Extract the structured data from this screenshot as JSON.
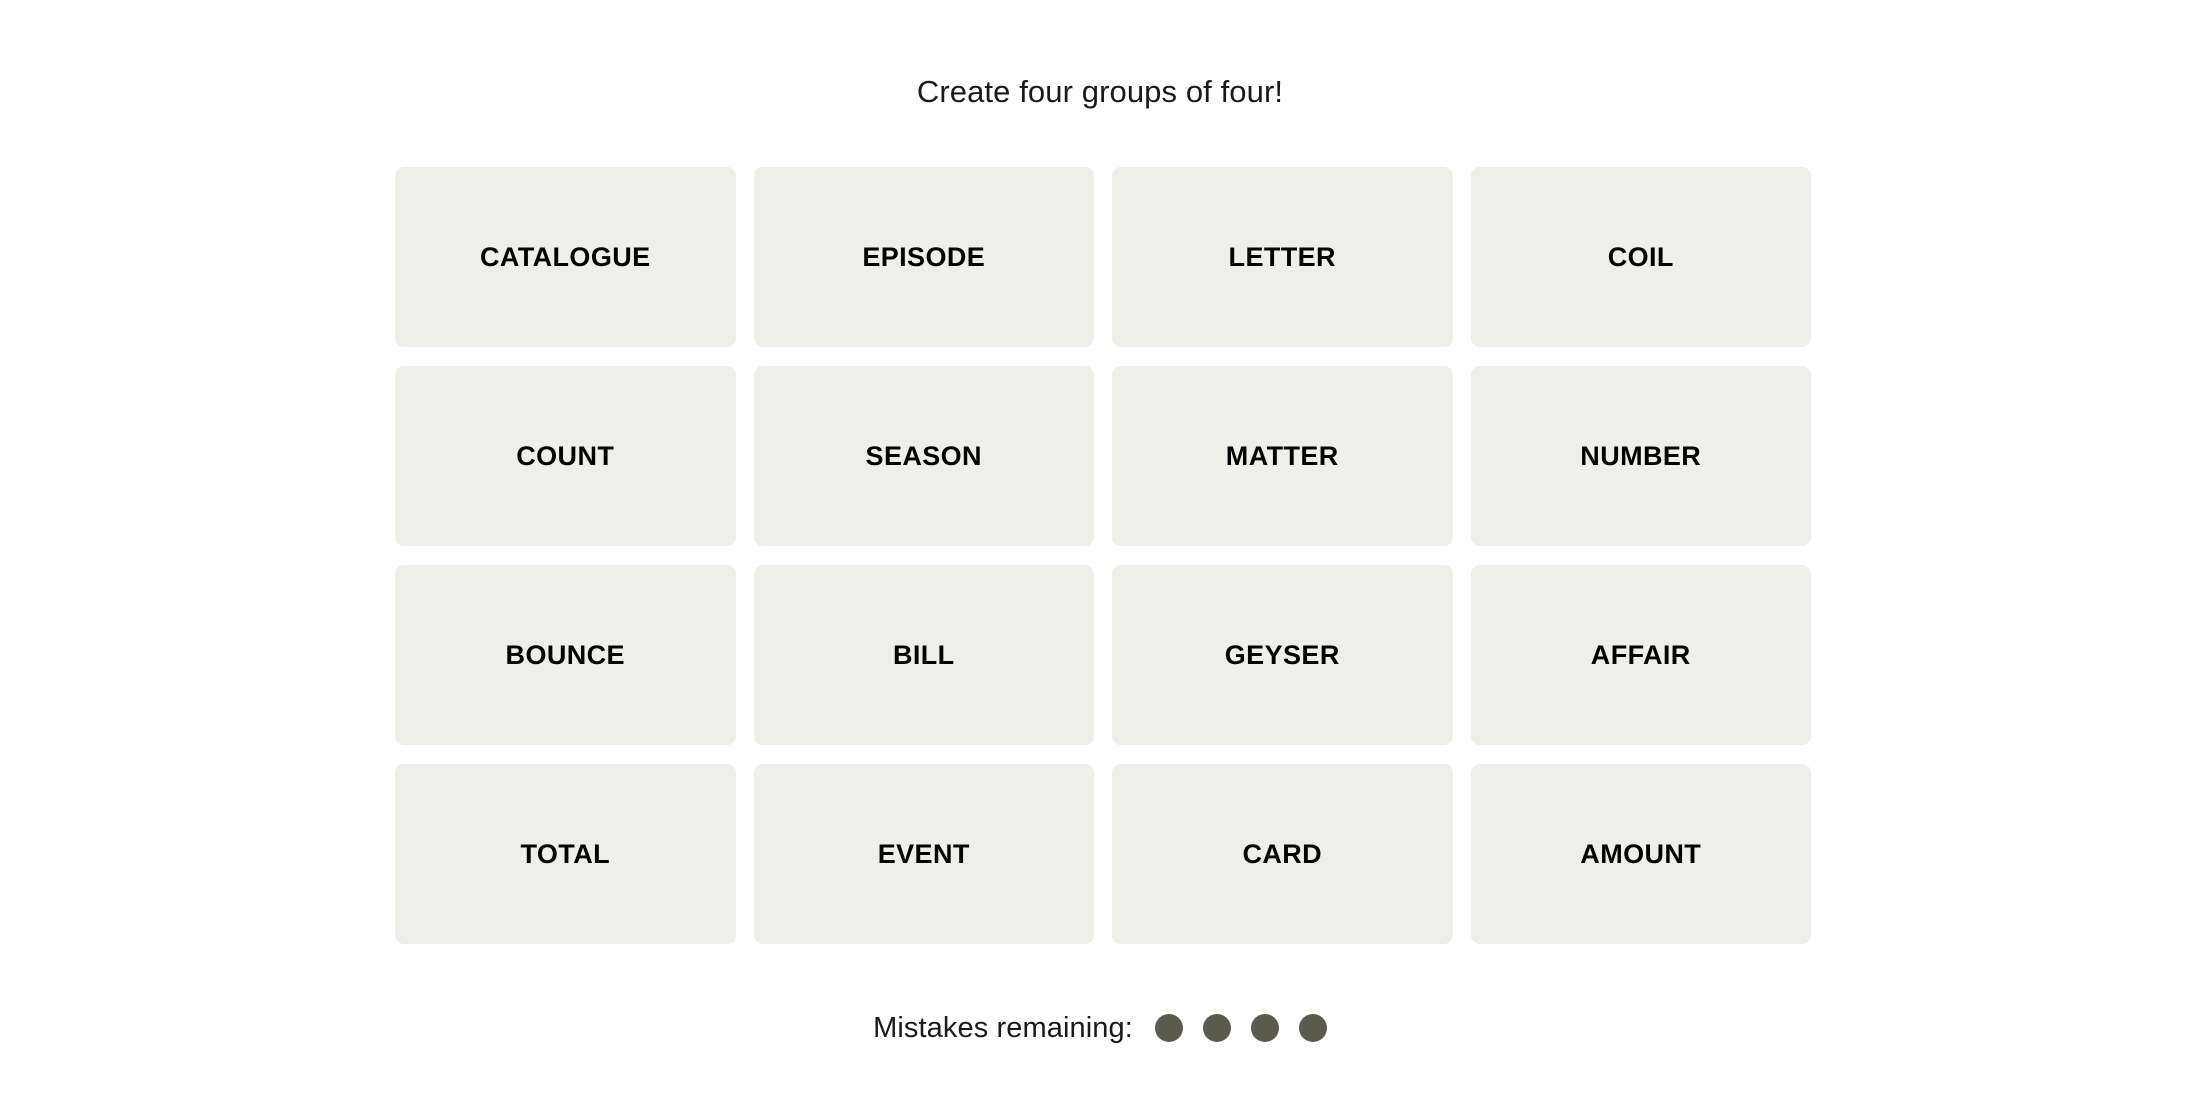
{
  "page": {
    "background_color": "#ffffff"
  },
  "header": {
    "instruction": "Create four groups of four!"
  },
  "board": {
    "rows": 4,
    "columns": 4,
    "tile_background_color": "#efefe9",
    "tile_text_color": "#020202",
    "tiles": [
      {
        "label": "CATALOGUE"
      },
      {
        "label": "EPISODE"
      },
      {
        "label": "LETTER"
      },
      {
        "label": "COIL"
      },
      {
        "label": "COUNT"
      },
      {
        "label": "SEASON"
      },
      {
        "label": "MATTER"
      },
      {
        "label": "NUMBER"
      },
      {
        "label": "BOUNCE"
      },
      {
        "label": "BILL"
      },
      {
        "label": "GEYSER"
      },
      {
        "label": "AFFAIR"
      },
      {
        "label": "TOTAL"
      },
      {
        "label": "EVENT"
      },
      {
        "label": "CARD"
      },
      {
        "label": "AMOUNT"
      }
    ]
  },
  "footer": {
    "mistakes_label": "Mistakes remaining:",
    "mistakes_remaining": 4,
    "dot_color": "#5a5a4e",
    "dots": [
      {
        "name": "mistake-dot-1"
      },
      {
        "name": "mistake-dot-2"
      },
      {
        "name": "mistake-dot-3"
      },
      {
        "name": "mistake-dot-4"
      }
    ]
  }
}
